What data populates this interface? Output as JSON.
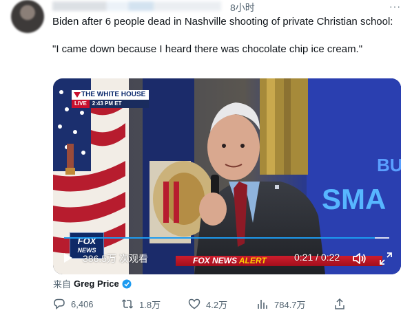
{
  "tweet": {
    "timestamp": "8小时",
    "more_icon": "more-horizontal-icon",
    "text_line1": "Biden after 6 people dead in Nashville shooting of private Christian school:",
    "text_quote": "\"I came down because I heard there was chocolate chip ice cream.\""
  },
  "video": {
    "banner_title": "THE WHITE HOUSE",
    "live_label": "LIVE",
    "live_time": "2:43 PM ET",
    "side_text_top": "BU",
    "side_text_mid": "SMA",
    "network_logo_line1": "FOX",
    "network_logo_line2": "NEWS",
    "alert_text": "FOX NEWS ",
    "alert_accent": "ALERT",
    "views": "386.5万 次观看",
    "time": "0:21 / 0:22",
    "progress": 0.955,
    "play_icon": "play-icon",
    "volume_icon": "volume-icon",
    "fullscreen_icon": "fullscreen-icon"
  },
  "via": {
    "prefix": "来自",
    "name": "Greg Price",
    "verified_icon": "verified-badge-icon"
  },
  "actions": {
    "replies": "6,406",
    "retweets": "1.8万",
    "likes": "4.2万",
    "views": "784.7万"
  },
  "colors": {
    "accent": "#1d9bf0",
    "text_secondary": "#536471",
    "alert_red": "#c8102e"
  }
}
